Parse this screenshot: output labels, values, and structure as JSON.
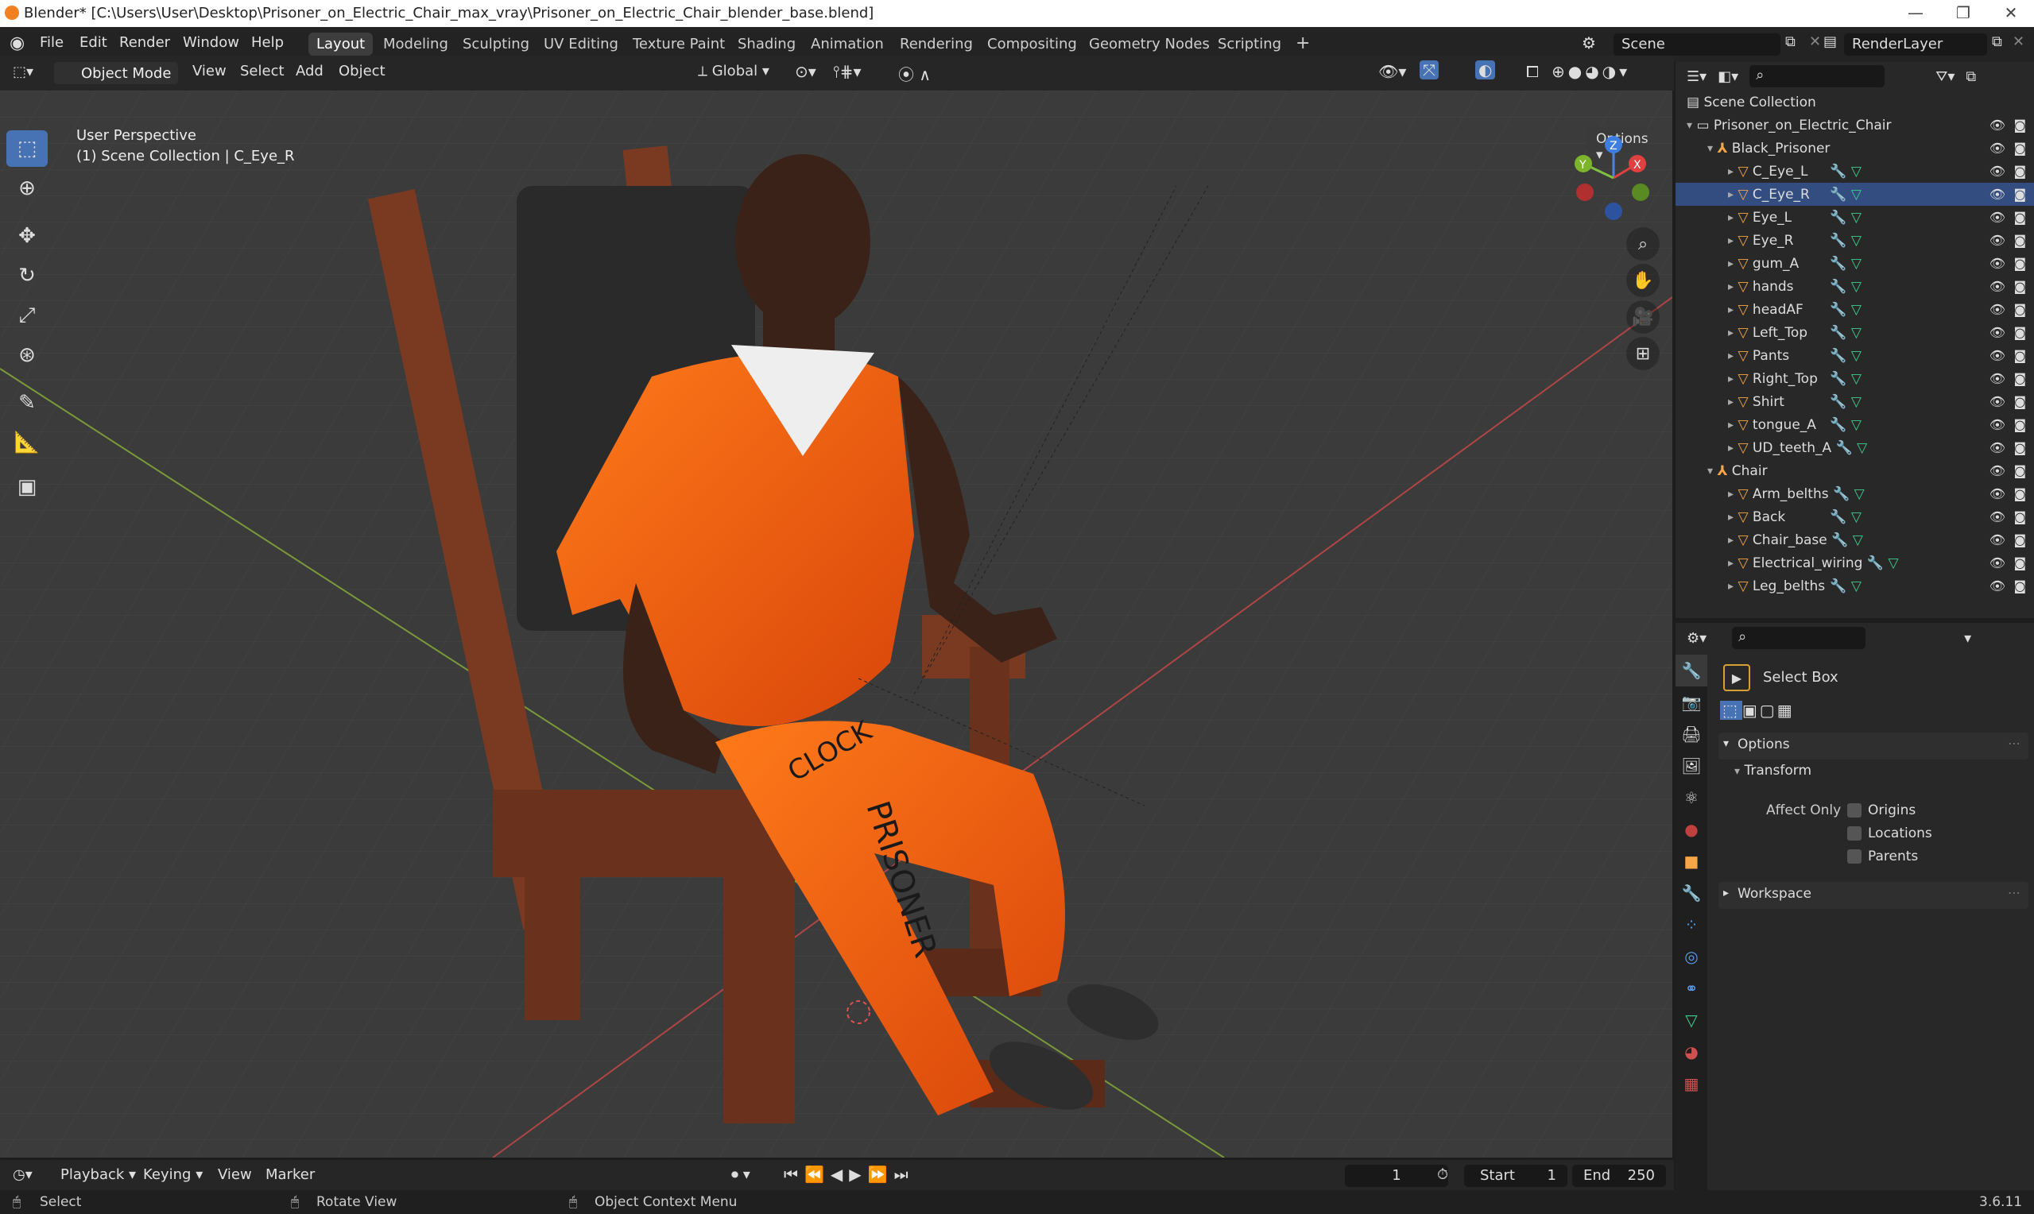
{
  "titlebar": {
    "title": "Blender* [C:\\Users\\User\\Desktop\\Prisoner_on_Electric_Chair_max_vray\\Prisoner_on_Electric_Chair_blender_base.blend]"
  },
  "menus": [
    "File",
    "Edit",
    "Render",
    "Window",
    "Help"
  ],
  "workspaces": [
    "Layout",
    "Modeling",
    "Sculpting",
    "UV Editing",
    "Texture Paint",
    "Shading",
    "Animation",
    "Rendering",
    "Compositing",
    "Geometry Nodes",
    "Scripting"
  ],
  "scene": {
    "name": "Scene",
    "layer": "RenderLayer"
  },
  "viewport_header": {
    "mode": "Object Mode",
    "view": "View",
    "select": "Select",
    "add": "Add",
    "object": "Object",
    "orientation": "Global",
    "options": "Options"
  },
  "viewport": {
    "perspective": "User Perspective",
    "collection": "(1) Scene Collection | C_Eye_R",
    "shirt_text": "CLOCK",
    "pants_text": "PRISONER"
  },
  "gizmo": {
    "x": "X",
    "y": "Y",
    "z": "Z"
  },
  "outliner": {
    "root": "Scene Collection",
    "collection": "Prisoner_on_Electric_Chair",
    "groups": [
      {
        "name": "Black_Prisoner",
        "items": [
          "C_Eye_L",
          "C_Eye_R",
          "Eye_L",
          "Eye_R",
          "gum_A",
          "hands",
          "headAF",
          "Left_Top",
          "Pants",
          "Right_Top",
          "Shirt",
          "tongue_A",
          "UD_teeth_A"
        ]
      },
      {
        "name": "Chair",
        "items": [
          "Arm_belths",
          "Back",
          "Chair_base",
          "Electrical_wiring",
          "Leg_belths"
        ]
      }
    ],
    "selected": "C_Eye_R"
  },
  "properties": {
    "tool": "Select Box",
    "options": "Options",
    "transform": "Transform",
    "affect_only": "Affect Only",
    "checks": [
      "Origins",
      "Locations",
      "Parents"
    ],
    "workspace": "Workspace"
  },
  "timeline": {
    "playback": "Playback",
    "keying": "Keying",
    "view": "View",
    "marker": "Marker",
    "frame": "1",
    "start_label": "Start",
    "start": "1",
    "end_label": "End",
    "end": "250"
  },
  "status": {
    "select": "Select",
    "rotate": "Rotate View",
    "context": "Object Context Menu",
    "version": "3.6.11"
  }
}
